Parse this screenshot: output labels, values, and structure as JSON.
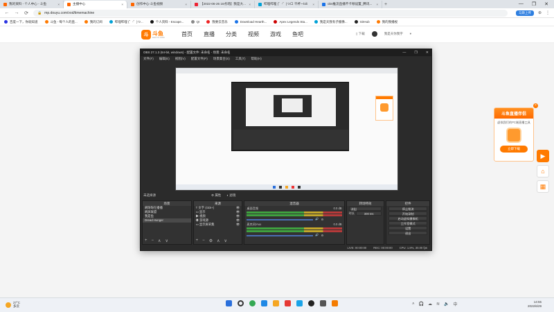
{
  "browser": {
    "tabs": [
      {
        "label": "我的资料 - 个人中心 - 斗鱼",
        "active": false
      },
      {
        "label": "主播中心",
        "active": true
      },
      {
        "label": "创作中心-斗鱼视频",
        "active": false
      },
      {
        "label": "【2022-06-26 16点场】我是大...",
        "active": false
      },
      {
        "label": "哔哩哔哩 (゜-゜)つロ 干杯~-bili",
        "active": false
      },
      {
        "label": "obs推流直播不卡顿设置_腾讯...",
        "active": false
      }
    ],
    "window_controls": [
      "—",
      "❐",
      "✕"
    ],
    "url": "mp.douyu.com/vod/timemachine",
    "notice": "马斯上传",
    "nav_buttons": [
      "←",
      "→",
      "⟳"
    ],
    "bookmarks": [
      "百度一下，你就知道",
      "斗鱼 - 每个人的直...",
      "我的订阅",
      "哔哩哔哩 (゜-゜)つ...",
      "个人资料 - Escape...",
      "QI",
      "我要云音乐",
      "Download Hearth...",
      "Apex Legends Sta...",
      "我是天我有子摄像...",
      "GitHub",
      "我的我播视"
    ]
  },
  "site": {
    "logo_badge": "斗",
    "logo_text": "斗鱼",
    "logo_sub": "DOUYU.COM",
    "nav": [
      "首页",
      "直播",
      "分类",
      "视频",
      "游戏",
      "鱼吧"
    ],
    "download": "下载",
    "user": "我是天你我字"
  },
  "obs": {
    "title": "OBS 27.1.3 (64-bit, windows) - 配置文件: 未命名 - 场景: 未命名",
    "window_controls": [
      "—",
      "❐",
      "✕"
    ],
    "menu": [
      "文件(F)",
      "编辑(E)",
      "视图(V)",
      "配置文件(P)",
      "场景集合(S)",
      "工具(T)",
      "帮助(H)"
    ],
    "scene_label": "未选择源",
    "properties": "属性",
    "filters": "滤镜",
    "panels": {
      "scenes": {
        "title": "场景",
        "items": [
          "刷呀呀在播播",
          "刷屏联盟",
          "我是鱼",
          "Dread Hunger"
        ],
        "selected": 3
      },
      "sources": {
        "title": "来源",
        "items": [
          "文字 (GDI+)",
          "显示",
          "视频",
          "游戏源",
          "显示屏采集"
        ]
      },
      "mixer": {
        "title": "混音器",
        "tracks": [
          {
            "name": "桌面音频",
            "db": "0.0 dB"
          },
          {
            "name": "麦克风/Aux",
            "db": "0.0 dB"
          }
        ]
      },
      "transitions": {
        "title": "转场特效",
        "type": "淡出",
        "duration_label": "时长",
        "duration": "300 ms"
      },
      "controls": {
        "title": "控件",
        "buttons": [
          "停止推流",
          "开始录制",
          "启动虚拟摄像机",
          "工作室模式",
          "设置",
          "退出"
        ]
      }
    },
    "status": {
      "live": "LIVE: 00:00:00",
      "rec": "REC: 00:00:00",
      "cpu": "CPU: 1.8%, 30.00 fps"
    }
  },
  "promo": {
    "title": "斗鱼直播伴侣",
    "subtitle": "虚拟我们的PC端直播工具",
    "button": "立即下载",
    "close": "×"
  },
  "taskbar": {
    "temp": "27°C",
    "weather": "多云",
    "time": "14:55",
    "date": "2022/6/29"
  }
}
